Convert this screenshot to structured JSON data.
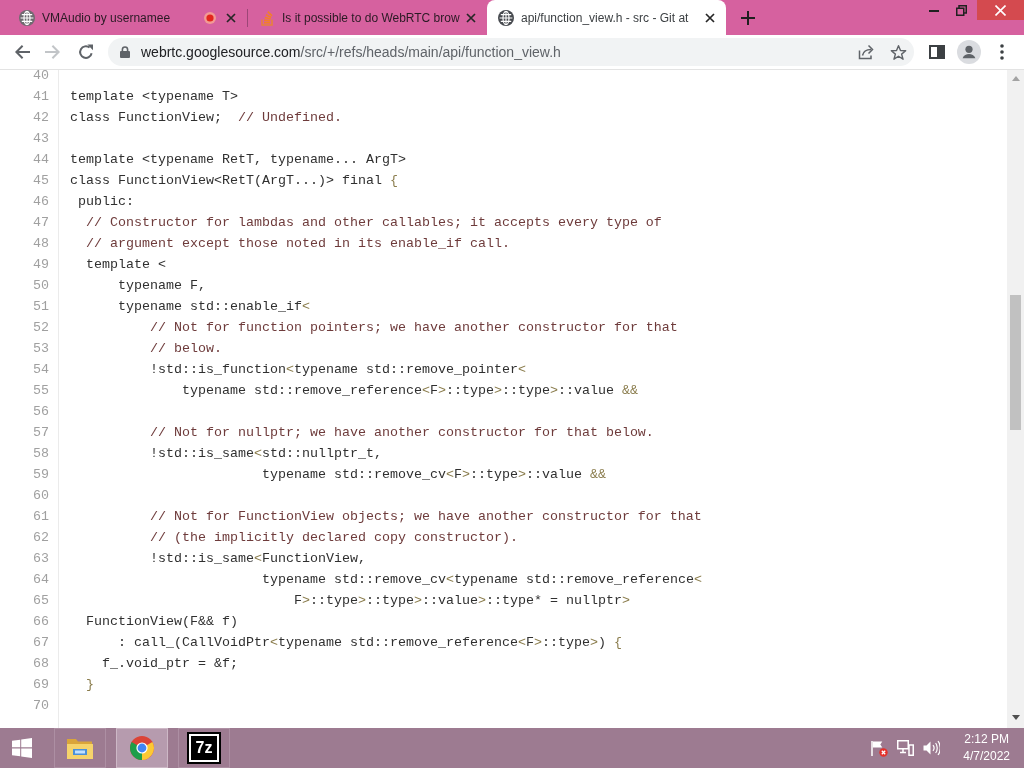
{
  "browser": {
    "tabs": [
      {
        "title": "VMAudio by usernamee",
        "kind": "globe",
        "recording": true,
        "selected": false
      },
      {
        "title": "Is it possible to do WebRTC brow",
        "kind": "stack",
        "recording": false,
        "selected": false
      },
      {
        "title": "api/function_view.h - src - Git at",
        "kind": "globe",
        "recording": false,
        "selected": true
      }
    ],
    "navigation": {
      "back": {
        "disabled": false
      },
      "forward": {
        "disabled": true
      }
    },
    "address_bar": {
      "host": "webrtc.googlesource.com",
      "path": "/src/+/refs/heads/main/api/function_view.h"
    }
  },
  "code": {
    "lines": [
      {
        "number": "40"
      },
      {
        "number": "41",
        "tokens": [
          {
            "kind": "code",
            "text": "template <typename T>"
          }
        ]
      },
      {
        "number": "42",
        "tokens": [
          {
            "kind": "code",
            "text": "class FunctionView;  "
          },
          {
            "kind": "comment",
            "text": "// Undefined."
          }
        ]
      },
      {
        "number": "43"
      },
      {
        "number": "44",
        "tokens": [
          {
            "kind": "code",
            "text": "template <typename RetT, typename... ArgT>"
          }
        ]
      },
      {
        "number": "45",
        "tokens": [
          {
            "kind": "code",
            "text": "class FunctionView<RetT(ArgT...)> final "
          },
          {
            "kind": "punct",
            "text": "{"
          }
        ]
      },
      {
        "number": "46",
        "tokens": [
          {
            "kind": "code",
            "text": " public:"
          }
        ]
      },
      {
        "number": "47",
        "tokens": [
          {
            "kind": "comment",
            "text": "  // Constructor for lambdas and other callables; it accepts every type of"
          }
        ]
      },
      {
        "number": "48",
        "tokens": [
          {
            "kind": "comment",
            "text": "  // argument except those noted in its enable_if call."
          }
        ]
      },
      {
        "number": "49",
        "tokens": [
          {
            "kind": "code",
            "text": "  template <"
          }
        ]
      },
      {
        "number": "50",
        "tokens": [
          {
            "kind": "code",
            "text": "      typename F,"
          }
        ]
      },
      {
        "number": "51",
        "tokens": [
          {
            "kind": "code",
            "text": "      typename std::enable_if"
          },
          {
            "kind": "punct",
            "text": "<"
          }
        ]
      },
      {
        "number": "52",
        "tokens": [
          {
            "kind": "comment",
            "text": "          // Not for function pointers; we have another constructor for that"
          }
        ]
      },
      {
        "number": "53",
        "tokens": [
          {
            "kind": "comment",
            "text": "          // below."
          }
        ]
      },
      {
        "number": "54",
        "tokens": [
          {
            "kind": "code",
            "text": "          !std::is_function"
          },
          {
            "kind": "punct",
            "text": "<"
          },
          {
            "kind": "code",
            "text": "typename std::remove_pointer"
          },
          {
            "kind": "punct",
            "text": "<"
          }
        ]
      },
      {
        "number": "55",
        "tokens": [
          {
            "kind": "code",
            "text": "              typename std::remove_reference"
          },
          {
            "kind": "punct",
            "text": "<"
          },
          {
            "kind": "code",
            "text": "F"
          },
          {
            "kind": "punct",
            "text": ">"
          },
          {
            "kind": "code",
            "text": "::type"
          },
          {
            "kind": "punct",
            "text": ">"
          },
          {
            "kind": "code",
            "text": "::type"
          },
          {
            "kind": "punct",
            "text": ">"
          },
          {
            "kind": "code",
            "text": "::value "
          },
          {
            "kind": "punct",
            "text": "&&"
          }
        ]
      },
      {
        "number": "56"
      },
      {
        "number": "57",
        "tokens": [
          {
            "kind": "comment",
            "text": "          // Not for nullptr; we have another constructor for that below."
          }
        ]
      },
      {
        "number": "58",
        "tokens": [
          {
            "kind": "code",
            "text": "          !std::is_same"
          },
          {
            "kind": "punct",
            "text": "<"
          },
          {
            "kind": "code",
            "text": "std::nullptr_t,"
          }
        ]
      },
      {
        "number": "59",
        "tokens": [
          {
            "kind": "code",
            "text": "                        typename std::remove_cv"
          },
          {
            "kind": "punct",
            "text": "<"
          },
          {
            "kind": "code",
            "text": "F"
          },
          {
            "kind": "punct",
            "text": ">"
          },
          {
            "kind": "code",
            "text": "::type"
          },
          {
            "kind": "punct",
            "text": ">"
          },
          {
            "kind": "code",
            "text": "::value "
          },
          {
            "kind": "punct",
            "text": "&&"
          }
        ]
      },
      {
        "number": "60"
      },
      {
        "number": "61",
        "tokens": [
          {
            "kind": "comment",
            "text": "          // Not for FunctionView objects; we have another constructor for that"
          }
        ]
      },
      {
        "number": "62",
        "tokens": [
          {
            "kind": "comment",
            "text": "          // (the implicitly declared copy constructor)."
          }
        ]
      },
      {
        "number": "63",
        "tokens": [
          {
            "kind": "code",
            "text": "          !std::is_same"
          },
          {
            "kind": "punct",
            "text": "<"
          },
          {
            "kind": "code",
            "text": "FunctionView,"
          }
        ]
      },
      {
        "number": "64",
        "tokens": [
          {
            "kind": "code",
            "text": "                        typename std::remove_cv"
          },
          {
            "kind": "punct",
            "text": "<"
          },
          {
            "kind": "code",
            "text": "typename std::remove_reference"
          },
          {
            "kind": "punct",
            "text": "<"
          }
        ]
      },
      {
        "number": "65",
        "tokens": [
          {
            "kind": "code",
            "text": "                            F"
          },
          {
            "kind": "punct",
            "text": ">"
          },
          {
            "kind": "code",
            "text": "::type"
          },
          {
            "kind": "punct",
            "text": ">"
          },
          {
            "kind": "code",
            "text": "::type"
          },
          {
            "kind": "punct",
            "text": ">"
          },
          {
            "kind": "code",
            "text": "::value"
          },
          {
            "kind": "punct",
            "text": ">"
          },
          {
            "kind": "code",
            "text": "::type* = nullptr"
          },
          {
            "kind": "punct",
            "text": ">"
          }
        ]
      },
      {
        "number": "66",
        "tokens": [
          {
            "kind": "code",
            "text": "  FunctionView(F&& f)"
          }
        ]
      },
      {
        "number": "67",
        "tokens": [
          {
            "kind": "code",
            "text": "      : call_(CallVoidPtr"
          },
          {
            "kind": "punct",
            "text": "<"
          },
          {
            "kind": "code",
            "text": "typename std::remove_reference"
          },
          {
            "kind": "punct",
            "text": "<"
          },
          {
            "kind": "code",
            "text": "F"
          },
          {
            "kind": "punct",
            "text": ">"
          },
          {
            "kind": "code",
            "text": "::type"
          },
          {
            "kind": "punct",
            "text": ">"
          },
          {
            "kind": "code",
            "text": ") "
          },
          {
            "kind": "punct",
            "text": "{"
          }
        ]
      },
      {
        "number": "68",
        "tokens": [
          {
            "kind": "code",
            "text": "    f_.void_ptr = &f;"
          }
        ]
      },
      {
        "number": "69",
        "tokens": [
          {
            "kind": "punct",
            "text": "  }"
          }
        ]
      },
      {
        "number": "70"
      }
    ]
  },
  "taskbar": {
    "apps": [
      {
        "kind": "folder",
        "selected": false
      },
      {
        "kind": "browser",
        "selected": true
      },
      {
        "kind": "archive",
        "logo_text": "7z",
        "selected": false
      }
    ],
    "clock": {
      "time": "2:12 PM",
      "date": "4/7/2022"
    }
  }
}
